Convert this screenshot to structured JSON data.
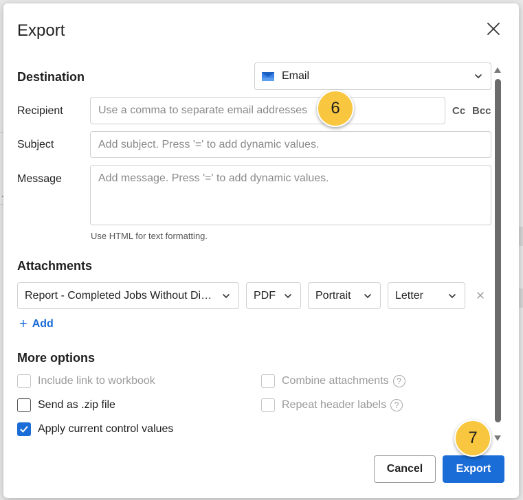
{
  "dialog": {
    "title": "Export"
  },
  "destination": {
    "label": "Destination",
    "selected": "Email",
    "icon": "envelope-icon"
  },
  "fields": {
    "recipient_label": "Recipient",
    "recipient_placeholder": "Use a comma to separate email addresses",
    "cc_label": "Cc",
    "bcc_label": "Bcc",
    "subject_label": "Subject",
    "subject_placeholder": "Add subject. Press '=' to add dynamic values.",
    "message_label": "Message",
    "message_placeholder": "Add message. Press '=' to add dynamic values.",
    "message_help": "Use HTML for text formatting."
  },
  "attachments": {
    "label": "Attachments",
    "items": [
      {
        "report": "Report - Completed Jobs Without Di…",
        "format": "PDF",
        "orientation": "Portrait",
        "page_size": "Letter"
      }
    ],
    "add_label": "Add"
  },
  "more_options": {
    "label": "More options",
    "include_link": {
      "label": "Include link to workbook",
      "checked": false,
      "disabled": true
    },
    "combine_attachments": {
      "label": "Combine attachments",
      "checked": false,
      "disabled": true
    },
    "send_zip": {
      "label": "Send as .zip file",
      "checked": false,
      "disabled": false
    },
    "repeat_header": {
      "label": "Repeat header labels",
      "checked": false,
      "disabled": true
    },
    "apply_control_values": {
      "label": "Apply current control values",
      "checked": true,
      "disabled": false
    }
  },
  "footer": {
    "cancel_label": "Cancel",
    "export_label": "Export"
  },
  "callouts": {
    "step_a": "6",
    "step_b": "7"
  },
  "colors": {
    "accent": "#1a6cd6",
    "callout": "#f8c63f",
    "help_icon": "?"
  }
}
